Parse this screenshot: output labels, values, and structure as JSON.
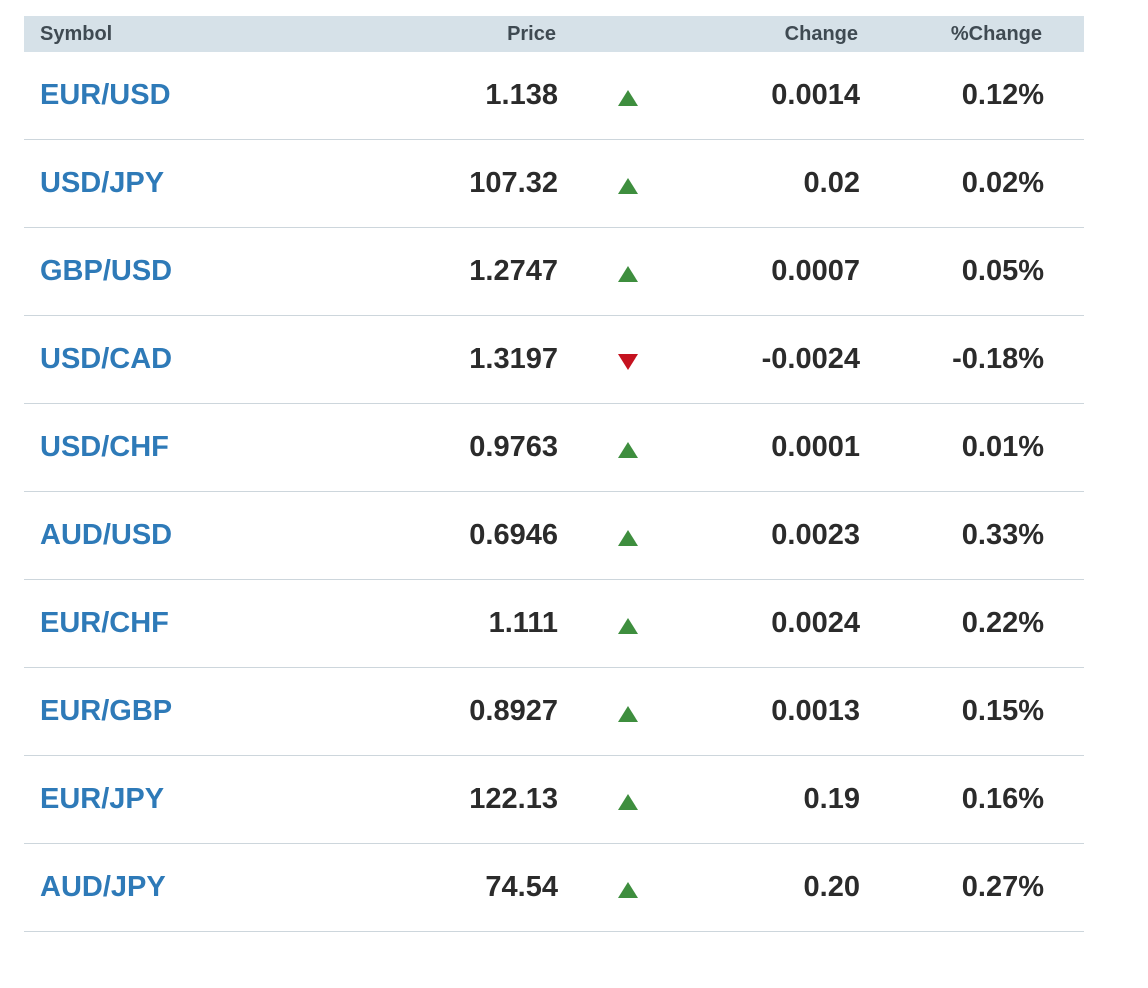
{
  "table": {
    "headers": {
      "symbol": "Symbol",
      "price": "Price",
      "change": "Change",
      "pct_change": "%Change"
    },
    "rows": [
      {
        "symbol": "EUR/USD",
        "price": "1.138",
        "direction": "up",
        "change": "0.0014",
        "pct_change": "0.12%"
      },
      {
        "symbol": "USD/JPY",
        "price": "107.32",
        "direction": "up",
        "change": "0.02",
        "pct_change": "0.02%"
      },
      {
        "symbol": "GBP/USD",
        "price": "1.2747",
        "direction": "up",
        "change": "0.0007",
        "pct_change": "0.05%"
      },
      {
        "symbol": "USD/CAD",
        "price": "1.3197",
        "direction": "down",
        "change": "-0.0024",
        "pct_change": "-0.18%"
      },
      {
        "symbol": "USD/CHF",
        "price": "0.9763",
        "direction": "up",
        "change": "0.0001",
        "pct_change": "0.01%"
      },
      {
        "symbol": "AUD/USD",
        "price": "0.6946",
        "direction": "up",
        "change": "0.0023",
        "pct_change": "0.33%"
      },
      {
        "symbol": "EUR/CHF",
        "price": "1.111",
        "direction": "up",
        "change": "0.0024",
        "pct_change": "0.22%"
      },
      {
        "symbol": "EUR/GBP",
        "price": "0.8927",
        "direction": "up",
        "change": "0.0013",
        "pct_change": "0.15%"
      },
      {
        "symbol": "EUR/JPY",
        "price": "122.13",
        "direction": "up",
        "change": "0.19",
        "pct_change": "0.16%"
      },
      {
        "symbol": "AUD/JPY",
        "price": "74.54",
        "direction": "up",
        "change": "0.20",
        "pct_change": "0.27%"
      }
    ]
  },
  "colors": {
    "header_bg": "#d6e1e8",
    "link": "#2e7ab8",
    "up": "#3e8e3e",
    "down": "#c5121f",
    "divider": "#cdd6dc"
  },
  "icons": {
    "up": "triangle-up-icon",
    "down": "triangle-down-icon"
  }
}
